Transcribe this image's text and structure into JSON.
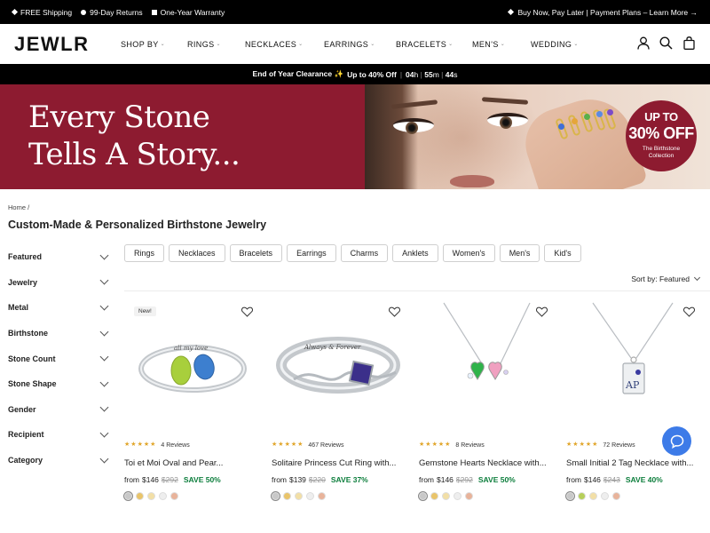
{
  "topbar": {
    "items": [
      "FREE Shipping",
      "99-Day Returns",
      "One-Year Warranty"
    ],
    "right": "Buy Now, Pay Later | Payment Plans – Learn More →"
  },
  "header": {
    "logo": "JEWLR",
    "nav": [
      "SHOP BY",
      "RINGS",
      "NECKLACES",
      "EARRINGS",
      "BRACELETS",
      "MEN'S",
      "WEDDING"
    ],
    "icons": [
      "user-icon",
      "search-icon",
      "bag-icon"
    ]
  },
  "promo": {
    "label": "End of Year Clearance ✨",
    "offer": "Up to 40% Off",
    "sep": "|",
    "hours": "04",
    "h": "h",
    "minutes": "55",
    "m": "m",
    "seconds": "44",
    "s": "s"
  },
  "hero": {
    "title_line1": "Every Stone",
    "title_line2": "Tells A Story...",
    "badge_line1": "UP TO",
    "badge_line2": "30% OFF",
    "badge_line3": "The Birthstone Collection"
  },
  "breadcrumb": "Home /",
  "page_title": "Custom-Made & Personalized Birthstone Jewelry",
  "filters": [
    "Featured",
    "Jewelry",
    "Metal",
    "Birthstone",
    "Stone Count",
    "Stone Shape",
    "Gender",
    "Recipient",
    "Category"
  ],
  "chips": [
    "Rings",
    "Necklaces",
    "Bracelets",
    "Earrings",
    "Charms",
    "Anklets",
    "Women's",
    "Men's",
    "Kid's"
  ],
  "sort": "Sort by: Featured",
  "products": [
    {
      "tag": "New!",
      "reviews": "4 Reviews",
      "name": "Toi et Moi Oval and Pear...",
      "from": "from",
      "price": "$146",
      "was": "$292",
      "save": "SAVE 50%",
      "engraving": "all my love"
    },
    {
      "tag": "",
      "reviews": "467 Reviews",
      "name": "Solitaire Princess Cut Ring with...",
      "from": "from",
      "price": "$139",
      "was": "$220",
      "save": "SAVE 37%",
      "engraving": "Always & Forever"
    },
    {
      "tag": "",
      "reviews": "8 Reviews",
      "name": "Gemstone Hearts Necklace with...",
      "from": "from",
      "price": "$146",
      "was": "$292",
      "save": "SAVE 50%"
    },
    {
      "tag": "",
      "reviews": "72 Reviews",
      "name": "Small Initial 2 Tag Necklace with...",
      "from": "from",
      "price": "$146",
      "was": "$243",
      "save": "SAVE 40%",
      "engraving": "AP"
    }
  ],
  "colors": {
    "brand": "#8d1b30",
    "save_green": "#0b7d3b",
    "star": "#e1a62b",
    "chat": "#3d7be8"
  },
  "swatch_colors": [
    "#c8c8c8",
    "#e9c46a",
    "#f2dfa6",
    "#eeeeee",
    "#e8b39a"
  ]
}
